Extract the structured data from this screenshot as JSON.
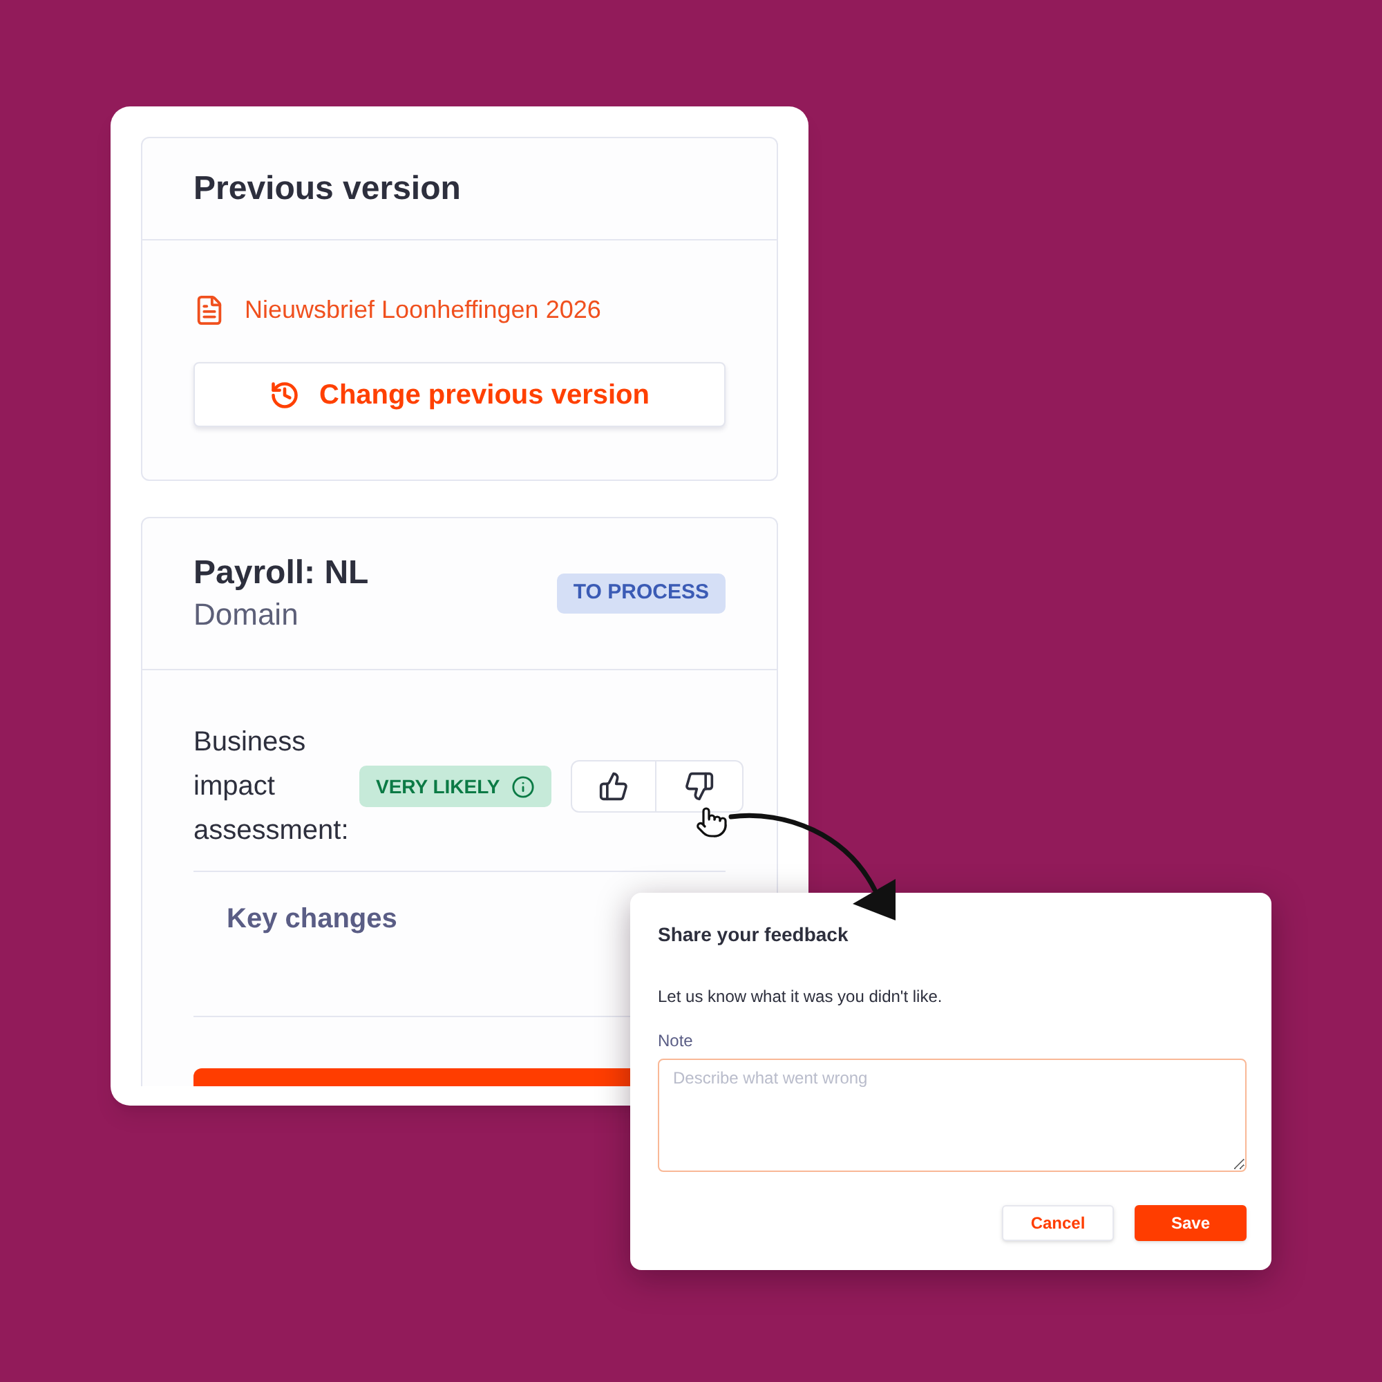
{
  "previous_version": {
    "title": "Previous version",
    "document_link": "Nieuwsbrief Loonheffingen 2026",
    "change_button": "Change previous version"
  },
  "domain_card": {
    "title": "Payroll: NL",
    "subtitle": "Domain",
    "status_badge": "TO PROCESS",
    "assessment_label": "Business impact assessment:",
    "assessment_badge": "VERY LIKELY",
    "key_changes_heading": "Key changes"
  },
  "feedback_dialog": {
    "title": "Share your feedback",
    "message": "Let us know what it was you didn't like.",
    "note": {
      "label": "Note",
      "placeholder": "Describe what went wrong"
    },
    "buttons": [
      {
        "label": "Cancel",
        "kind": "secondary"
      },
      {
        "label": "Save",
        "kind": "primary"
      }
    ]
  }
}
